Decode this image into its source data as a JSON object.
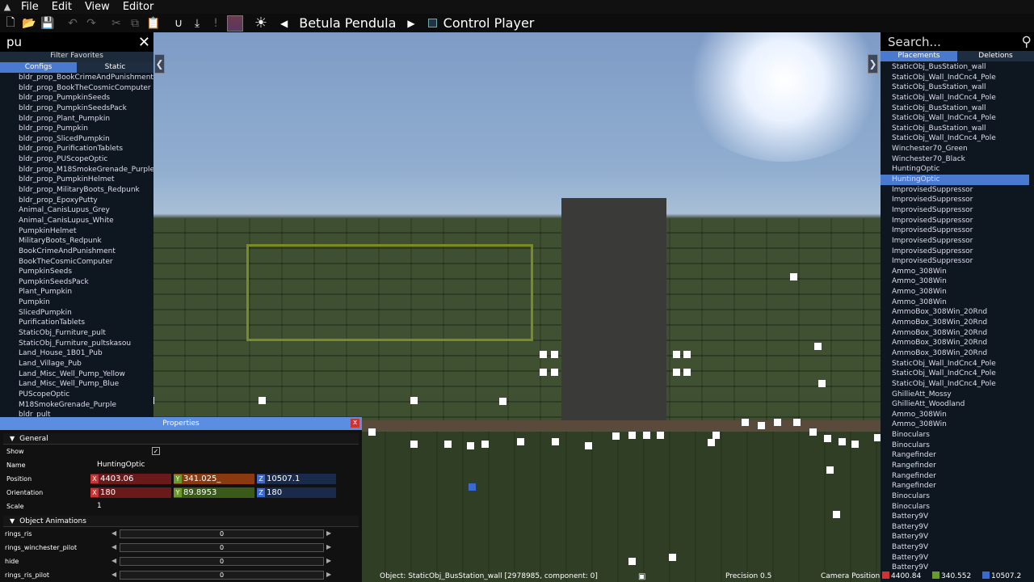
{
  "menu": {
    "items": [
      "File",
      "Edit",
      "View",
      "Editor"
    ]
  },
  "toolbar": {
    "preset_name": "Betula Pendula",
    "control_player_label": "Control Player",
    "accent": "#6b3b4a"
  },
  "left_panel": {
    "search_value": "pu",
    "filter_favorites": "Filter Favorites",
    "tabs": [
      "Configs",
      "Static"
    ],
    "items": [
      "bldr_prop_BookCrimeAndPunishment",
      "bldr_prop_BookTheCosmicComputer",
      "bldr_prop_PumpkinSeeds",
      "bldr_prop_PumpkinSeedsPack",
      "bldr_prop_Plant_Pumpkin",
      "bldr_prop_Pumpkin",
      "bldr_prop_SlicedPumpkin",
      "bldr_prop_PurificationTablets",
      "bldr_prop_PUScopeOptic",
      "bldr_prop_M18SmokeGrenade_Purple",
      "bldr_prop_PumpkinHelmet",
      "bldr_prop_MilitaryBoots_Redpunk",
      "bldr_prop_EpoxyPutty",
      "Animal_CanisLupus_Grey",
      "Animal_CanisLupus_White",
      "PumpkinHelmet",
      "MilitaryBoots_Redpunk",
      "BookCrimeAndPunishment",
      "BookTheCosmicComputer",
      "PumpkinSeeds",
      "PumpkinSeedsPack",
      "Plant_Pumpkin",
      "Pumpkin",
      "SlicedPumpkin",
      "PurificationTablets",
      "StaticObj_Furniture_pult",
      "StaticObj_Furniture_pultskasou",
      "Land_House_1B01_Pub",
      "Land_Village_Pub",
      "Land_Misc_Well_Pump_Yellow",
      "Land_Misc_Well_Pump_Blue",
      "PUScopeOptic",
      "M18SmokeGrenade_Purple",
      "bldr_pult"
    ]
  },
  "right_panel": {
    "search_placeholder": "Search...",
    "tabs": [
      "Placements",
      "Deletions"
    ],
    "selected_index": 11,
    "items": [
      "StaticObj_BusStation_wall",
      "StaticObj_Wall_IndCnc4_Pole",
      "StaticObj_BusStation_wall",
      "StaticObj_Wall_IndCnc4_Pole",
      "StaticObj_BusStation_wall",
      "StaticObj_Wall_IndCnc4_Pole",
      "StaticObj_BusStation_wall",
      "StaticObj_Wall_IndCnc4_Pole",
      "Winchester70_Green",
      "Winchester70_Black",
      "HuntingOptic",
      "HuntingOptic",
      "ImprovisedSuppressor",
      "ImprovisedSuppressor",
      "ImprovisedSuppressor",
      "ImprovisedSuppressor",
      "ImprovisedSuppressor",
      "ImprovisedSuppressor",
      "ImprovisedSuppressor",
      "ImprovisedSuppressor",
      "Ammo_308Win",
      "Ammo_308Win",
      "Ammo_308Win",
      "Ammo_308Win",
      "AmmoBox_308Win_20Rnd",
      "AmmoBox_308Win_20Rnd",
      "AmmoBox_308Win_20Rnd",
      "AmmoBox_308Win_20Rnd",
      "AmmoBox_308Win_20Rnd",
      "StaticObj_Wall_IndCnc4_Pole",
      "StaticObj_Wall_IndCnc4_Pole",
      "StaticObj_Wall_IndCnc4_Pole",
      "GhillieAtt_Mossy",
      "GhillieAtt_Woodland",
      "Ammo_308Win",
      "Ammo_308Win",
      "Binoculars",
      "Binoculars",
      "Rangefinder",
      "Rangefinder",
      "Rangefinder",
      "Rangefinder",
      "Binoculars",
      "Binoculars",
      "Battery9V",
      "Battery9V",
      "Battery9V",
      "Battery9V",
      "Battery9V",
      "Battery9V"
    ]
  },
  "properties": {
    "title": "Properties",
    "close_label": "x",
    "general_label": "General",
    "show_label": "Show",
    "name_label": "Name",
    "name_value": "HuntingOptic",
    "position_label": "Position",
    "position": {
      "x": "4403.06",
      "y": "341.025_",
      "z": "10507.1"
    },
    "orientation_label": "Orientation",
    "orientation": {
      "x": "180",
      "y": "89.8953",
      "z": "180"
    },
    "scale_label": "Scale",
    "scale_value": "1",
    "animations_label": "Object Animations",
    "animations": [
      {
        "name": "rings_ris",
        "value": "0"
      },
      {
        "name": "rings_winchester_pilot",
        "value": "0"
      },
      {
        "name": "hide",
        "value": "0"
      },
      {
        "name": "rings_ris_pilot",
        "value": "0"
      }
    ]
  },
  "status": {
    "object": "Object: StaticObj_BusStation_wall [2978985, component: 0]",
    "precision": "Precision 0.5",
    "camera_label": "Camera Position",
    "camera_x": "4400.84",
    "camera_y": "340.552",
    "camera_z": "10507.2"
  },
  "axis_labels": {
    "x": "X",
    "y": "Y",
    "z": "Z"
  }
}
